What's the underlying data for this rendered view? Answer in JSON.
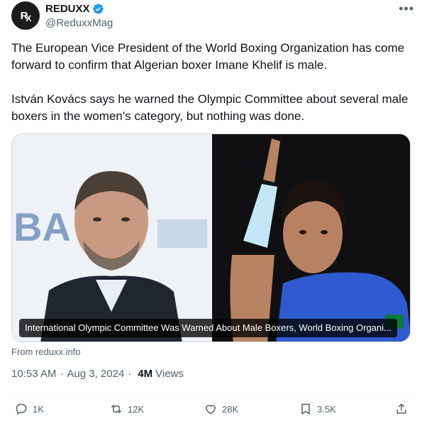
{
  "author": {
    "name": "REDUXX",
    "handle": "@ReduxxMag",
    "avatar_text": "R",
    "avatar_text2": "X"
  },
  "menu_icon": "more-icon",
  "verified_icon": "verified-badge-icon",
  "tweet": {
    "paragraph1": "The European Vice President of the World Boxing Organization has come forward to confirm that Algerian boxer Imane Khelif is male.",
    "paragraph2": "István Kovács says he warned the Olympic Committee about several male boxers in the women's category, but nothing was done."
  },
  "card": {
    "title": "International Olympic Committee Was Warned About Male Boxers, World Boxing Organi...",
    "source": "From reduxx.info"
  },
  "meta": {
    "time": "10:53 AM",
    "date": "Aug 3, 2024",
    "separator": "·",
    "views_count": "4M",
    "views_label": "Views"
  },
  "actions": {
    "replies": "1K",
    "reposts": "12K",
    "likes": "28K",
    "bookmarks": "3.5K"
  },
  "colors": {
    "accent": "#1d9bf0",
    "text_secondary": "#536471"
  }
}
